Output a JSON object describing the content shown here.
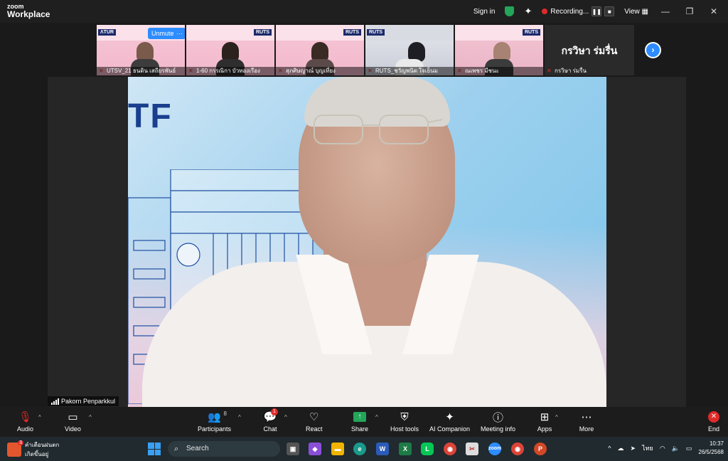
{
  "app": {
    "logo_line1": "zoom",
    "logo_line2": "Workplace",
    "sign_in": "Sign in",
    "recording": "Recording...",
    "view": "View",
    "accent": "#2d8cff",
    "danger": "#e02b2b"
  },
  "strip": {
    "unmute": "Unmute",
    "more": "···",
    "tiles": [
      {
        "name": "UTSV_21 ธนดิน เสถียรพันธ์",
        "brand": "ɅTUR"
      },
      {
        "name": "1-60 กรรณิกา บัวทองเรือง",
        "brand": "RUTS"
      },
      {
        "name": "สุภศิษญาณ์ บุญเที่ยง",
        "brand": "RUTS"
      },
      {
        "name": "RUTS_ชวัญพนิต ใจเย็นม",
        "brand": "RUTS"
      },
      {
        "name": "ณเพชร มีชนะ",
        "brand": "RUTS"
      }
    ],
    "name_tile": {
      "big": "กรวิษา ร่มรื่น",
      "name": "กรวิษา ร่มรื่น"
    }
  },
  "main_video": {
    "speaker": "Pakorn Penparkkul",
    "background_text": "TF"
  },
  "toolbar": {
    "audio": "Audio",
    "video": "Video",
    "participants": "Participants",
    "participants_count": "8",
    "chat": "Chat",
    "chat_badge": "1",
    "react": "React",
    "share": "Share",
    "host_tools": "Host tools",
    "ai_companion": "AI Companion",
    "meeting_info": "Meeting info",
    "apps": "Apps",
    "more": "More",
    "end": "End"
  },
  "taskbar": {
    "weather_title": "คำเตือนฝนตก",
    "weather_sub": "เกิดขึ้นอยู่",
    "weather_badge": "3",
    "search": "Search",
    "lang": "ไทย",
    "time": "10:37",
    "date": "26/5/2568"
  }
}
